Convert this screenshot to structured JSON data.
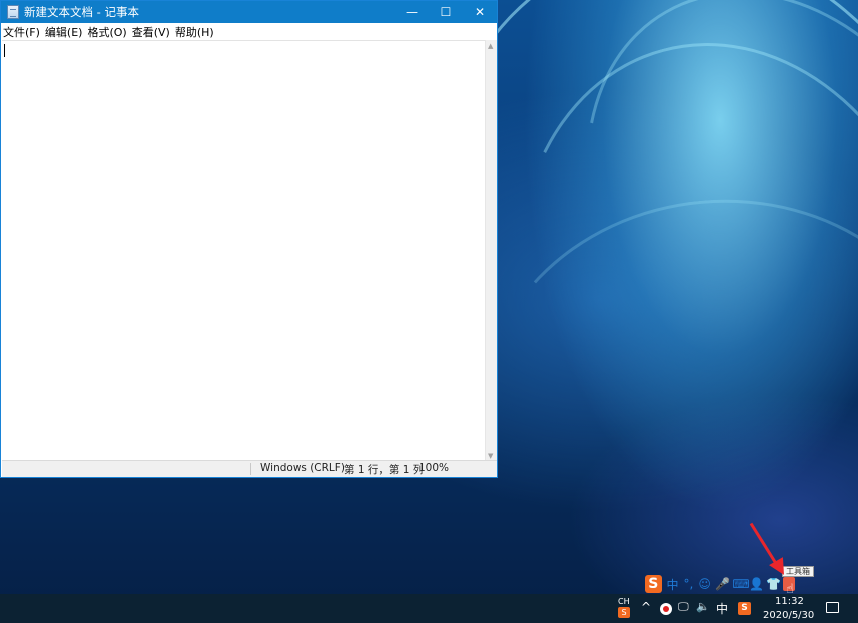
{
  "notepad": {
    "title": "新建文本文档 - 记事本",
    "controls": {
      "minimize": "—",
      "maximize": "☐",
      "close": "✕"
    },
    "menu": [
      "文件(F)",
      "编辑(E)",
      "格式(O)",
      "查看(V)",
      "帮助(H)"
    ],
    "content": "",
    "status": {
      "encoding": "Windows (CRLF)",
      "position": "第 1 行，第 1 列",
      "zoom": "100%"
    }
  },
  "ime_toolbar": {
    "logo": "S",
    "mode": "中",
    "punct": "°,",
    "emoji": "☺",
    "voice": "🎤",
    "keyboard": "⌨",
    "user": "👤",
    "skin": "👕",
    "toolbox_tooltip": "工具箱"
  },
  "taskbar": {
    "lang_top": "CH",
    "lang_bottom": "S",
    "chevron": "^",
    "ime_mode": "中",
    "sogou": "S",
    "time": "11:32",
    "date": "2020/5/30"
  },
  "colors": {
    "titlebar": "#0f7dc9",
    "taskbar": "#0c2233",
    "sogou": "#f26a21",
    "annotation_arrow": "#e8262c"
  }
}
